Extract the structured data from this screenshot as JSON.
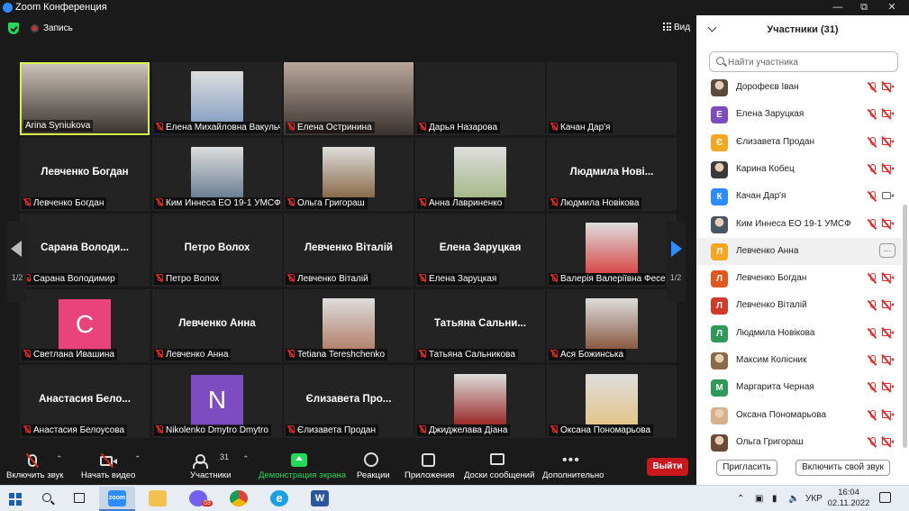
{
  "window": {
    "title": "Zoom Конференция"
  },
  "topbar": {
    "record_label": "Запись",
    "view_label": "Вид"
  },
  "gallery": {
    "page_left": "1/2",
    "page_right": "1/2",
    "tiles": [
      {
        "caption": "Arina Syniukova",
        "big": "",
        "kind": "video",
        "color": "#c9c2b8",
        "muted": false,
        "active": true
      },
      {
        "caption": "Елена Михайловна Вакульч...",
        "big": "",
        "kind": "photo",
        "color": "#8aa3c4",
        "muted": true
      },
      {
        "caption": "Елена Остринина",
        "big": "",
        "kind": "video",
        "color": "#b9a79b",
        "muted": true
      },
      {
        "caption": "Дарья Назарова",
        "big": "",
        "kind": "none",
        "muted": true
      },
      {
        "caption": "Качан Дар'я",
        "big": "",
        "kind": "none",
        "muted": true
      },
      {
        "caption": "Левченко Богдан",
        "big": "Левченко Богдан",
        "kind": "none",
        "muted": true
      },
      {
        "caption": "Ким Иннеса ЕО 19-1 УМСФ",
        "big": "",
        "kind": "photo",
        "color": "#6c7f93",
        "muted": true
      },
      {
        "caption": "Ольга Григораш",
        "big": "",
        "kind": "photo",
        "color": "#8a6a4a",
        "muted": true
      },
      {
        "caption": "Анна Лавриненко",
        "big": "",
        "kind": "photo",
        "color": "#a8b98a",
        "muted": true
      },
      {
        "caption": "Людмила Новікова",
        "big": "Людмила Нові...",
        "kind": "none",
        "muted": true
      },
      {
        "caption": "Сарана Володимир",
        "big": "Сарана Володи...",
        "kind": "none",
        "muted": true
      },
      {
        "caption": "Петро Волох",
        "big": "Петро Волох",
        "kind": "none",
        "muted": true
      },
      {
        "caption": "Левченко Віталій",
        "big": "Левченко Віталій",
        "kind": "none",
        "muted": true
      },
      {
        "caption": "Елена Заруцкая",
        "big": "Елена Заруцкая",
        "kind": "none",
        "muted": true
      },
      {
        "caption": "Валерія Валеріївна Фесенко",
        "big": "",
        "kind": "photo",
        "color": "#d84a4a",
        "muted": true
      },
      {
        "caption": "Светлана Ивашина",
        "big": "",
        "kind": "letter",
        "letter": "C",
        "color": "#e8437a",
        "muted": true
      },
      {
        "caption": "Левченко Анна",
        "big": "Левченко Анна",
        "kind": "none",
        "muted": true
      },
      {
        "caption": "Tetiana Tereshchenko",
        "big": "",
        "kind": "photo",
        "color": "#b4826e",
        "muted": true
      },
      {
        "caption": "Татьяна Сальникова",
        "big": "Татьяна Сальни...",
        "kind": "none",
        "muted": true
      },
      {
        "caption": "Ася Божинська",
        "big": "",
        "kind": "photo",
        "color": "#8a5a44",
        "muted": true
      },
      {
        "caption": "Анастасия Белоусова",
        "big": "Анастасия Бело...",
        "kind": "none",
        "muted": true
      },
      {
        "caption": "Nikolenko Dmytro Dmytro",
        "big": "",
        "kind": "letter",
        "letter": "N",
        "color": "#7d4cc0",
        "muted": true
      },
      {
        "caption": "Єлизавета Продан",
        "big": "Єлизавета Про...",
        "kind": "none",
        "muted": true
      },
      {
        "caption": "Джиджелава Діана",
        "big": "",
        "kind": "photo",
        "color": "#9a2a2a",
        "muted": true
      },
      {
        "caption": "Оксана Пономарьова",
        "big": "",
        "kind": "photo",
        "color": "#e3c58a",
        "muted": true
      }
    ]
  },
  "toolbar": {
    "mute_label": "Включить звук",
    "video_label": "Начать видео",
    "participants_label": "Участники",
    "participants_count": "31",
    "share_label": "Демонстрация экрана",
    "reactions_label": "Реакции",
    "apps_label": "Приложения",
    "boards_label": "Доски сообщений",
    "more_label": "Дополнительно",
    "leave_label": "Выйти"
  },
  "panel": {
    "title": "Участники (31)",
    "search_placeholder": "Найти участника",
    "participants": [
      {
        "name": "Дорофеєв Іван",
        "avatar": "",
        "color": "#5a4a3e",
        "cam": "off"
      },
      {
        "name": "Елена Заруцкая",
        "avatar": "Е",
        "color": "#7d4cc0",
        "cam": "off"
      },
      {
        "name": "Єлизавета Продан",
        "avatar": "Є",
        "color": "#f5a623",
        "cam": "off"
      },
      {
        "name": "Карина Кобец",
        "avatar": "",
        "color": "#3a3a3a",
        "cam": "off"
      },
      {
        "name": "Качан Дар'я",
        "avatar": "К",
        "color": "#2d8cff",
        "cam": "on"
      },
      {
        "name": "Ким Иннеса ЕО 19-1 УМСФ",
        "avatar": "",
        "color": "#4a5566",
        "cam": "off"
      },
      {
        "name": "Левченко Анна",
        "avatar": "Л",
        "color": "#f5a623",
        "cam": "more",
        "highlight": true
      },
      {
        "name": "Левченко Богдан",
        "avatar": "Л",
        "color": "#e0581f",
        "cam": "off"
      },
      {
        "name": "Левченко Віталій",
        "avatar": "Л",
        "color": "#d13a2a",
        "cam": "off"
      },
      {
        "name": "Людмила Новікова",
        "avatar": "Л",
        "color": "#2e9a57",
        "cam": "off"
      },
      {
        "name": "Максим Колісник",
        "avatar": "",
        "color": "#8a6a4a",
        "cam": "off"
      },
      {
        "name": "Маргарита Черная",
        "avatar": "М",
        "color": "#2e9a57",
        "cam": "off"
      },
      {
        "name": "Оксана Пономарьова",
        "avatar": "",
        "color": "#d8b08a",
        "cam": "off"
      },
      {
        "name": "Ольга Григораш",
        "avatar": "",
        "color": "#6a4a34",
        "cam": "off"
      }
    ],
    "invite_label": "Пригласить",
    "unmute_label": "Включить свой звук"
  },
  "taskbar": {
    "zoom_label": "zoom",
    "viber_badge": "03",
    "lang": "УКР",
    "time": "16:04",
    "date": "02.11.2022"
  }
}
